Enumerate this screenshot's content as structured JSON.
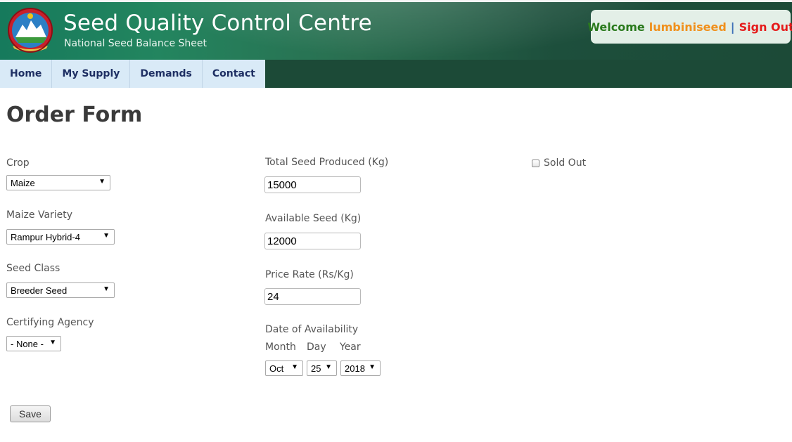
{
  "header": {
    "title": "Seed Quality Control Centre",
    "subtitle": "National Seed Balance Sheet",
    "welcome": "Welcome",
    "username": "lumbiniseed",
    "separator": "|",
    "signout": "Sign Out",
    "emblem_icon": "nepal-emblem-icon"
  },
  "nav": {
    "items": [
      {
        "label": "Home"
      },
      {
        "label": "My Supply"
      },
      {
        "label": "Demands"
      },
      {
        "label": "Contact"
      }
    ]
  },
  "page": {
    "title": "Order Form"
  },
  "form": {
    "crop": {
      "label": "Crop",
      "value": "Maize"
    },
    "variety": {
      "label": "Maize Variety",
      "value": "Rampur Hybrid-4"
    },
    "seed_class": {
      "label": "Seed Class",
      "value": "Breeder Seed"
    },
    "agency": {
      "label": "Certifying Agency",
      "value": "- None -"
    },
    "total_seed": {
      "label": "Total Seed Produced (Kg)",
      "value": "15000"
    },
    "available_seed": {
      "label": "Available Seed (Kg)",
      "value": "12000"
    },
    "price_rate": {
      "label": "Price Rate (Rs/Kg)",
      "value": "24"
    },
    "date": {
      "label": "Date of Availability",
      "month_label": "Month",
      "day_label": "Day",
      "year_label": "Year",
      "month": "Oct",
      "day": "25",
      "year": "2018"
    },
    "sold_out": {
      "label": "Sold Out",
      "checked": false
    },
    "save_label": "Save"
  },
  "colors": {
    "header_dark": "#1c4a37",
    "nav_bg": "#d9eaf7",
    "welcome": "#2a7a1d",
    "username": "#f0901c",
    "signout": "#e51b1b"
  }
}
